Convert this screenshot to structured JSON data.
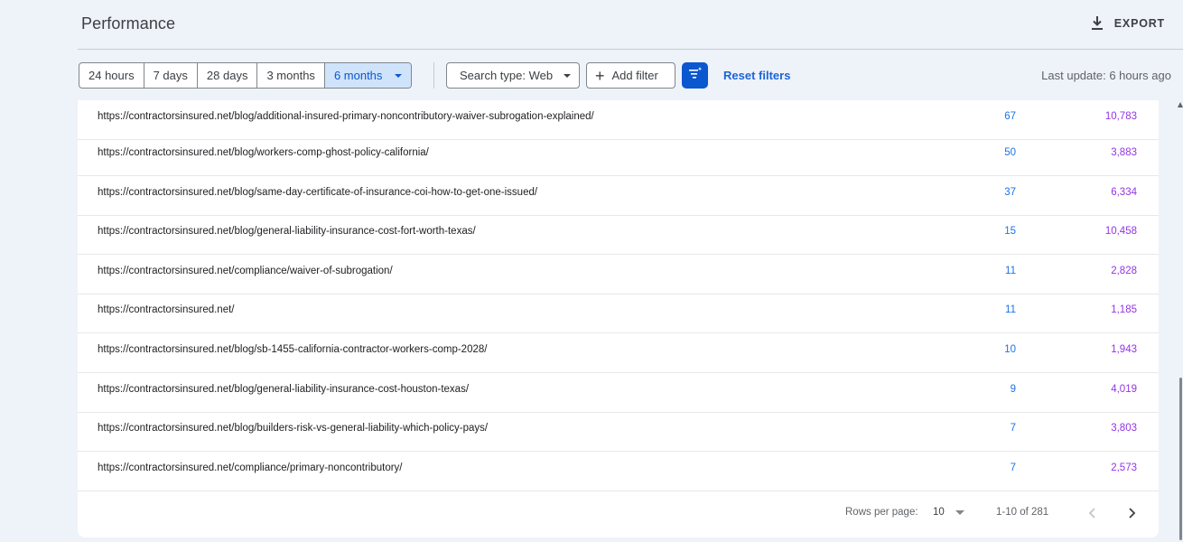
{
  "header": {
    "title": "Performance",
    "export_label": "EXPORT"
  },
  "filters": {
    "date_ranges": [
      "24 hours",
      "7 days",
      "28 days",
      "3 months",
      "6 months"
    ],
    "selected_range": "6 months",
    "search_type": "Search type: Web",
    "add_filter": "Add filter",
    "reset_filters": "Reset filters",
    "last_update": "Last update: 6 hours ago"
  },
  "table": {
    "rows": [
      {
        "url": "https://contractorsinsured.net/blog/additional-insured-primary-noncontributory-waiver-subrogation-explained/",
        "clicks": "67",
        "impressions": "10,783"
      },
      {
        "url": "https://contractorsinsured.net/blog/workers-comp-ghost-policy-california/",
        "clicks": "50",
        "impressions": "3,883"
      },
      {
        "url": "https://contractorsinsured.net/blog/same-day-certificate-of-insurance-coi-how-to-get-one-issued/",
        "clicks": "37",
        "impressions": "6,334"
      },
      {
        "url": "https://contractorsinsured.net/blog/general-liability-insurance-cost-fort-worth-texas/",
        "clicks": "15",
        "impressions": "10,458"
      },
      {
        "url": "https://contractorsinsured.net/compliance/waiver-of-subrogation/",
        "clicks": "11",
        "impressions": "2,828"
      },
      {
        "url": "https://contractorsinsured.net/",
        "clicks": "11",
        "impressions": "1,185"
      },
      {
        "url": "https://contractorsinsured.net/blog/sb-1455-california-contractor-workers-comp-2028/",
        "clicks": "10",
        "impressions": "1,943"
      },
      {
        "url": "https://contractorsinsured.net/blog/general-liability-insurance-cost-houston-texas/",
        "clicks": "9",
        "impressions": "4,019"
      },
      {
        "url": "https://contractorsinsured.net/blog/builders-risk-vs-general-liability-which-policy-pays/",
        "clicks": "7",
        "impressions": "3,803"
      },
      {
        "url": "https://contractorsinsured.net/compliance/primary-noncontributory/",
        "clicks": "7",
        "impressions": "2,573"
      }
    ]
  },
  "pagination": {
    "rows_per_page_label": "Rows per page:",
    "rows_per_page": "10",
    "range": "1-10 of 281"
  },
  "colors": {
    "clicks": "#1a73e8",
    "impressions": "#9334e6",
    "accent": "#0b57d0"
  },
  "icons": [
    "download-icon",
    "dropdown-caret-icon",
    "plus-icon",
    "filter-sort-icon",
    "chevron-left-icon",
    "chevron-right-icon"
  ]
}
